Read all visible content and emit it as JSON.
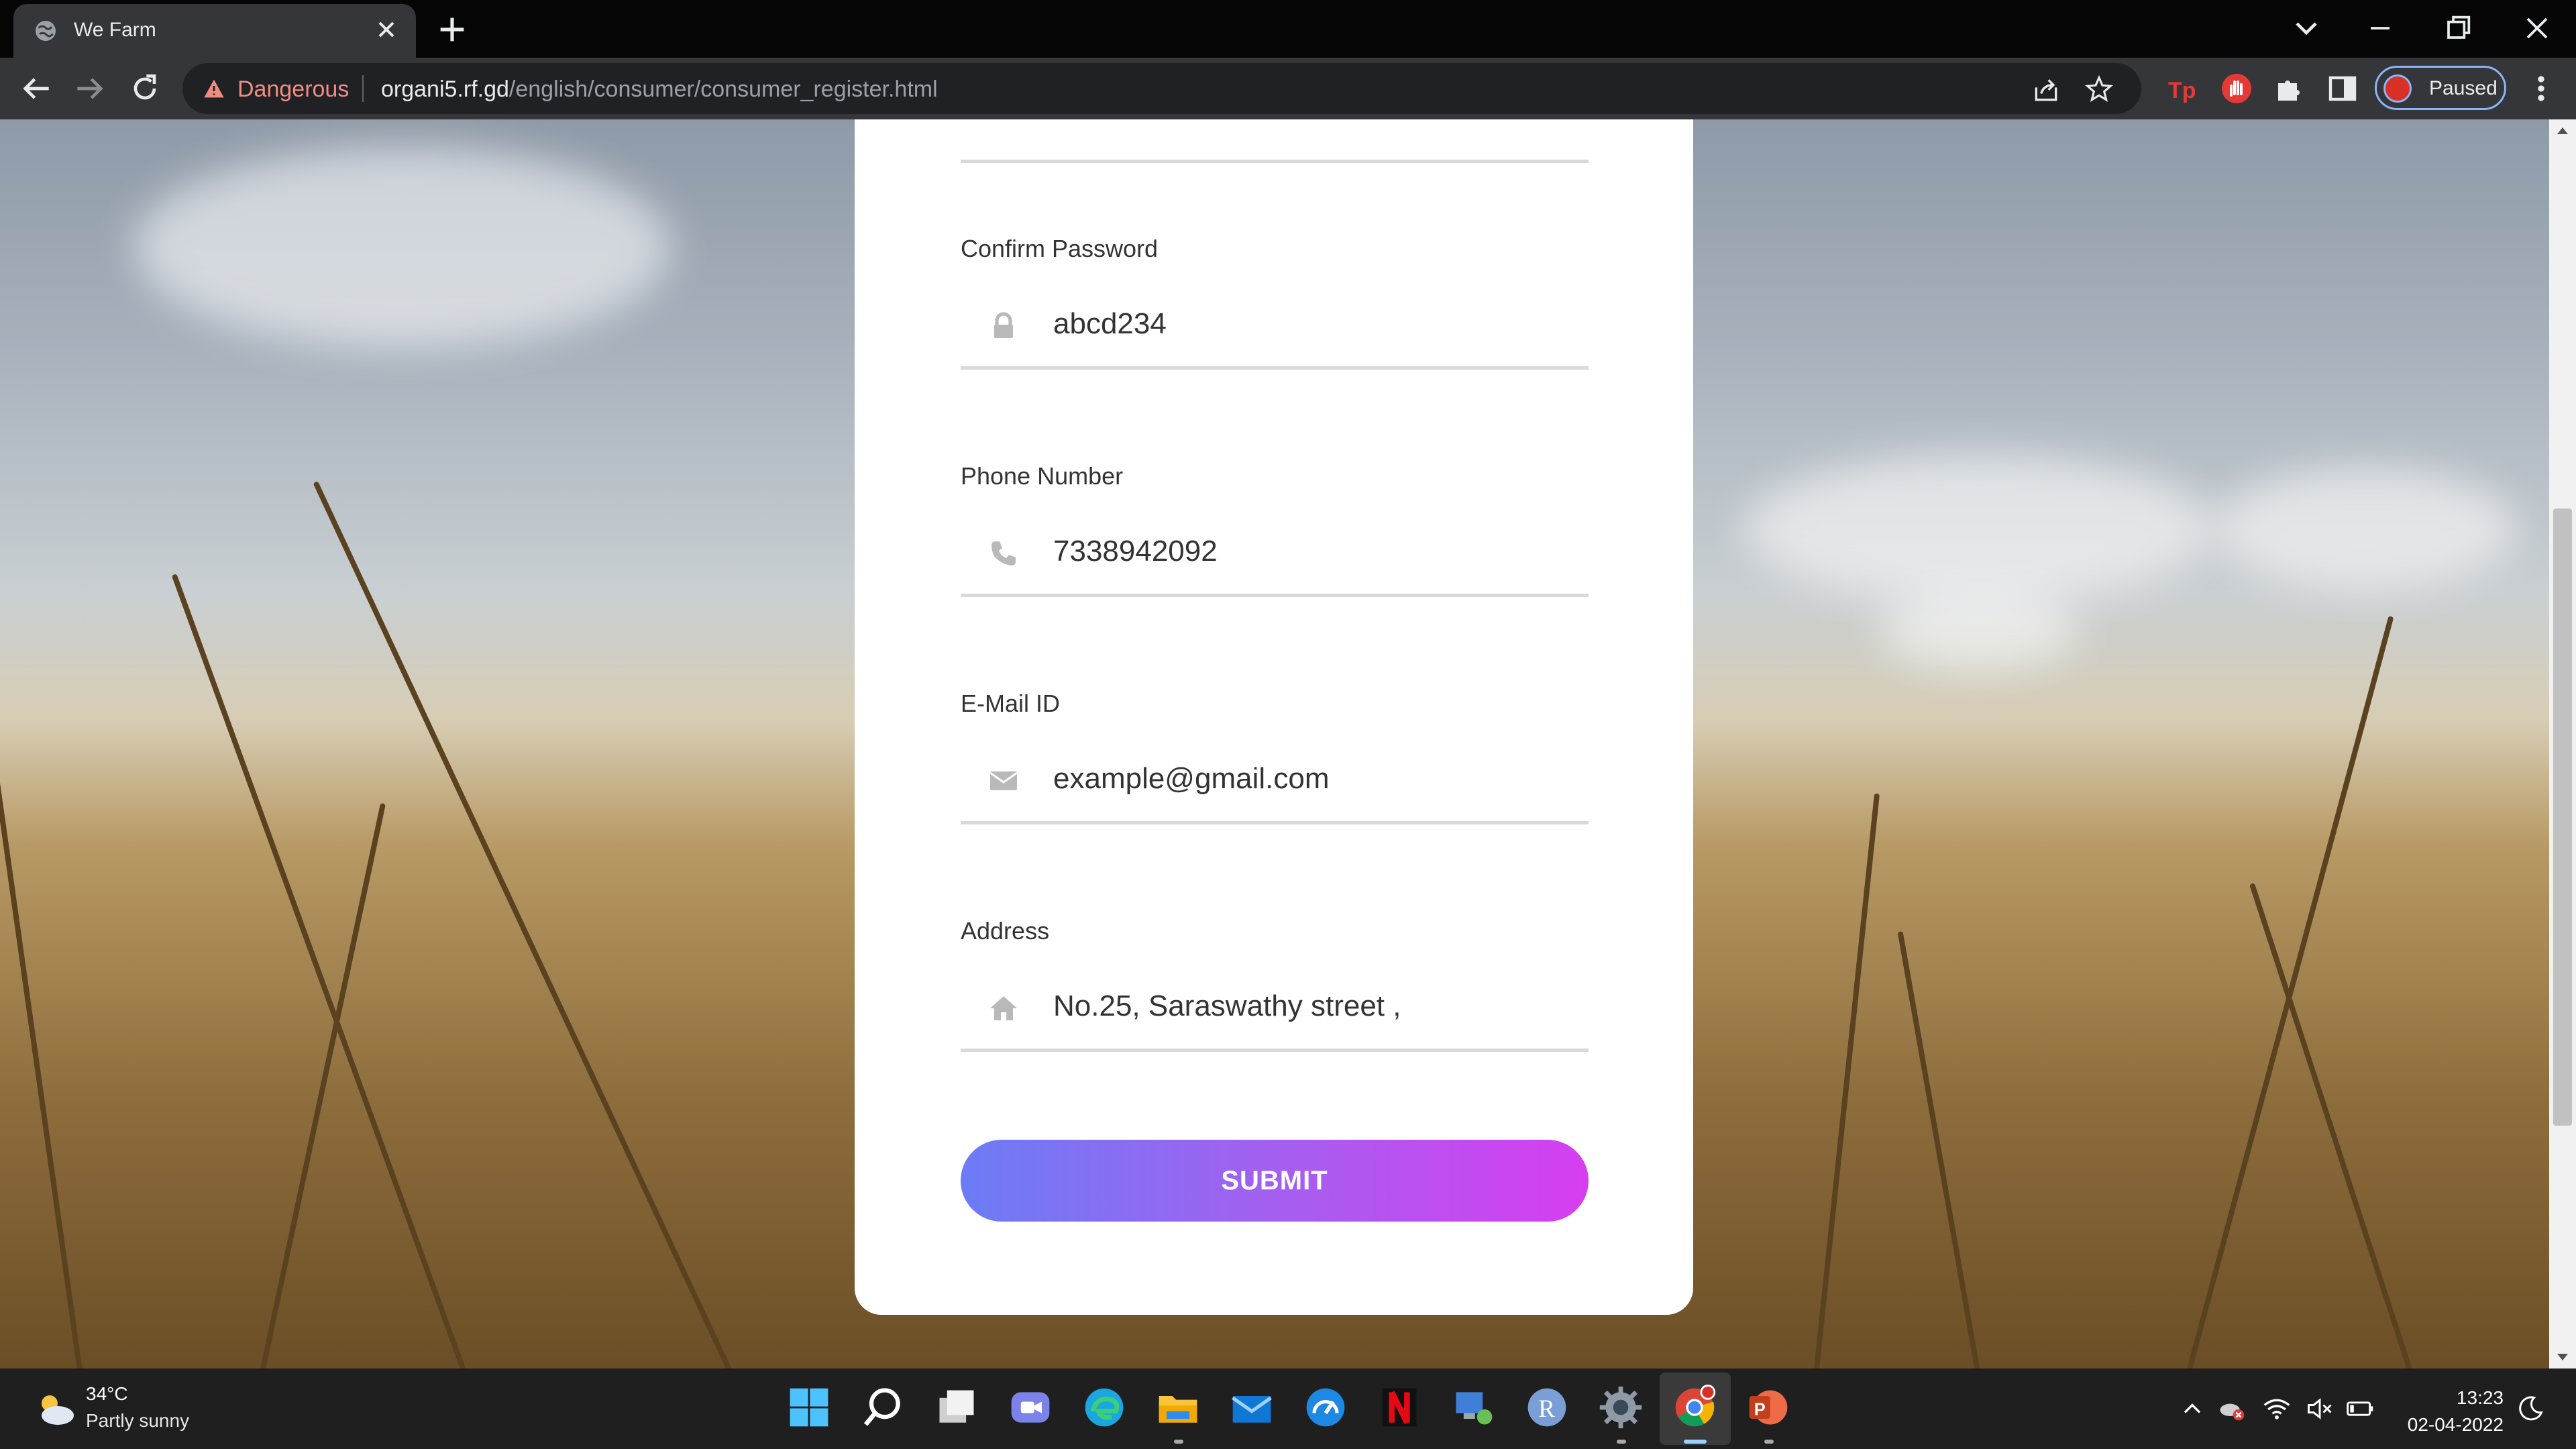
{
  "browser": {
    "tab_title": "We Farm",
    "security_label": "Dangerous",
    "url_host": "organi5.rf.gd",
    "url_path": "/english/consumer/consumer_register.html",
    "profile_status": "Paused"
  },
  "form": {
    "fields": [
      {
        "label": "Confirm Password",
        "value": "abcd234",
        "icon": "lock-icon"
      },
      {
        "label": "Phone Number",
        "value": "7338942092",
        "icon": "phone-icon"
      },
      {
        "label": "E-Mail ID",
        "value": "example@gmail.com",
        "icon": "envelope-icon"
      },
      {
        "label": "Address",
        "value": "No.25, Saraswathy street ,",
        "icon": "home-icon"
      }
    ],
    "submit_label": "SUBMIT",
    "submit_gradient": [
      "#6b7cf5",
      "#d63ef0"
    ]
  },
  "taskbar": {
    "weather_temp": "34°C",
    "weather_condition": "Partly sunny",
    "time": "13:23",
    "date": "02-04-2022"
  }
}
